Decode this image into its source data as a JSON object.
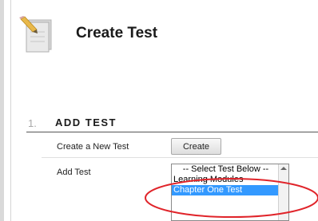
{
  "header": {
    "title": "Create Test",
    "icon": "test-document-pencil-icon"
  },
  "section": {
    "number": "1.",
    "title": "ADD TEST"
  },
  "form": {
    "create_label": "Create a New Test",
    "create_button_label": "Create",
    "add_label": "Add Test",
    "test_list": {
      "options": [
        "-- Select Test Below --",
        "Learning Modules",
        "Chapter One Test"
      ],
      "selected": "Chapter One Test"
    }
  },
  "colors": {
    "selection": "#3399ff",
    "annotation": "#e0242a"
  }
}
